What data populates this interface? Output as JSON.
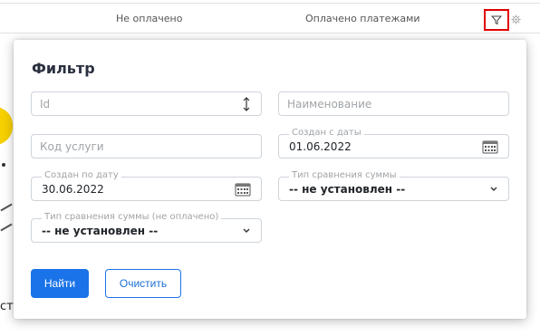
{
  "table": {
    "col_unpaid": "Не оплачено",
    "col_paid": "Оплачено платежами",
    "filter_icon": "filter-icon",
    "settings_icon": "gear-icon"
  },
  "background": {
    "partial_text": "ст"
  },
  "modal": {
    "title": "Фильтр",
    "fields": {
      "id": {
        "placeholder": "Id"
      },
      "name": {
        "placeholder": "Наименование"
      },
      "service_code": {
        "placeholder": "Код услуги"
      },
      "created_from": {
        "label": "Создан с даты",
        "value": "01.06.2022"
      },
      "created_to": {
        "label": "Создан по дату",
        "value": "30.06.2022"
      },
      "amount_compare": {
        "label": "Тип сравнения суммы",
        "value": "-- не установлен --"
      },
      "amount_compare_unpaid": {
        "label": "Тип сравнения суммы (не оплачено)",
        "value": "-- не установлен --"
      }
    },
    "buttons": {
      "find": "Найти",
      "clear": "Очистить"
    }
  },
  "colors": {
    "primary": "#1a73e8",
    "highlight_border": "#e00000",
    "placeholder": "#a0a4a8"
  }
}
